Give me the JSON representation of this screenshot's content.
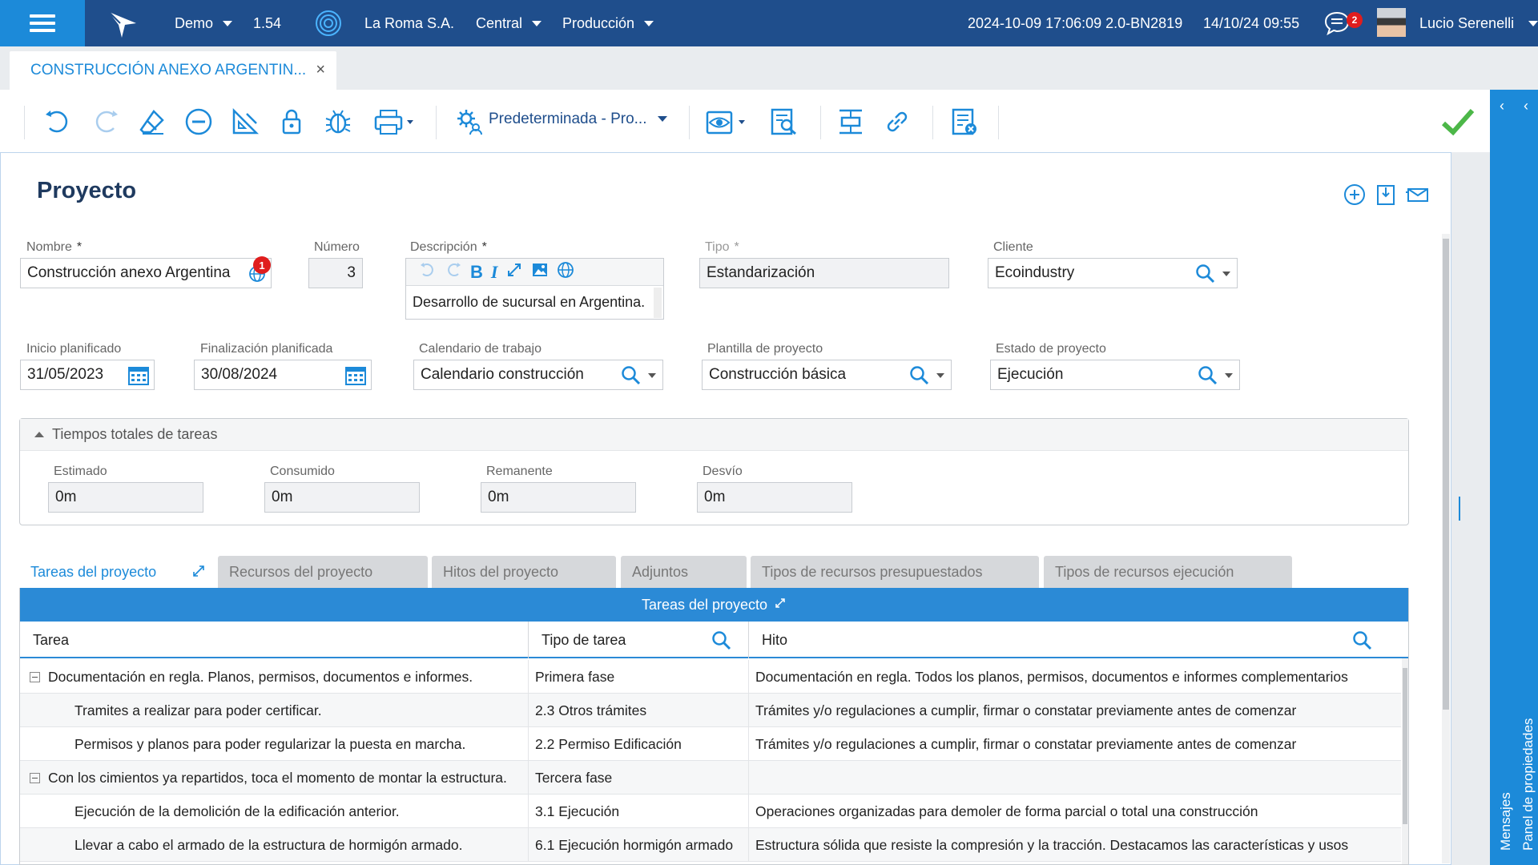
{
  "topbar": {
    "company_switch": "Demo",
    "version": "1.54",
    "organization": "La Roma S.A.",
    "branch": "Central",
    "environment": "Producción",
    "build_info": "2024-10-09 17:06:09 2.0-BN2819",
    "datetime": "14/10/24 09:55",
    "notifications_count": "2",
    "user_name": "Lucio Serenelli",
    "icons": [
      "menu-icon",
      "app-logo-icon",
      "org-logo-icon",
      "chat-icon",
      "avatar"
    ]
  },
  "doc_tab": {
    "title": "CONSTRUCCIÓN ANEXO ARGENTIN...",
    "close": "×"
  },
  "toolbar": {
    "layout_label": "Predeterminada - Pro...",
    "icons": [
      "undo-icon",
      "redo-icon",
      "eraser-icon",
      "remove-icon",
      "ruler-icon",
      "lock-icon",
      "bug-icon",
      "print-icon",
      "layout-gear-icon",
      "view-icon",
      "report-icon",
      "align-icon",
      "link-icon",
      "list-cancel-icon",
      "save-check-icon"
    ]
  },
  "form": {
    "title": "Proyecto",
    "nombre": {
      "label": "Nombre",
      "required": "*",
      "value": "Construcción anexo Argentina",
      "badge": "1"
    },
    "numero": {
      "label": "Número",
      "value": "3"
    },
    "descripcion": {
      "label": "Descripción",
      "required": "*",
      "value": "Desarrollo de sucursal en Argentina."
    },
    "tipo": {
      "label": "Tipo",
      "required": "*",
      "value": "Estandarización"
    },
    "cliente": {
      "label": "Cliente",
      "value": "Ecoindustry"
    },
    "inicio": {
      "label": "Inicio planificado",
      "value": "31/05/2023"
    },
    "fin": {
      "label": "Finalización planificada",
      "value": "30/08/2024"
    },
    "calendario": {
      "label": "Calendario de trabajo",
      "value": "Calendario construcción"
    },
    "plantilla": {
      "label": "Plantilla de proyecto",
      "value": "Construcción básica"
    },
    "estado": {
      "label": "Estado de proyecto",
      "value": "Ejecución"
    }
  },
  "tiempos": {
    "title": "Tiempos totales de tareas",
    "estimado": {
      "label": "Estimado",
      "value": "0m"
    },
    "consumido": {
      "label": "Consumido",
      "value": "0m"
    },
    "remanente": {
      "label": "Remanente",
      "value": "0m"
    },
    "desvio": {
      "label": "Desvío",
      "value": "0m"
    }
  },
  "subtabs": [
    "Tareas del proyecto",
    "Recursos del proyecto",
    "Hitos del proyecto",
    "Adjuntos",
    "Tipos de recursos presupuestados",
    "Tipos de recursos ejecución"
  ],
  "grid": {
    "title": "Tareas del proyecto",
    "columns": [
      "Tarea",
      "Tipo de tarea",
      "Hito"
    ],
    "rows": [
      {
        "tarea": "Documentación en regla. Planos, permisos, documentos e informes.",
        "tipo": "Primera fase",
        "hito": "Documentación en regla. Todos los planos, permisos, documentos e informes complementarios"
      },
      {
        "tarea": "Tramites a realizar para poder certificar.",
        "tipo": "2.3 Otros trámites",
        "hito": "Trámites y/o regulaciones a cumplir, firmar o constatar previamente antes de comenzar"
      },
      {
        "tarea": "Permisos y planos para poder regularizar la puesta en marcha.",
        "tipo": "2.2 Permiso Edificación",
        "hito": "Trámites y/o regulaciones a cumplir, firmar o constatar previamente antes de comenzar"
      },
      {
        "tarea": "Con los cimientos ya repartidos, toca el momento de montar la estructura.",
        "tipo": "Tercera fase",
        "hito": ""
      },
      {
        "tarea": "Ejecución de la demolición de la edificación anterior.",
        "tipo": "3.1 Ejecución",
        "hito": "Operaciones organizadas para demoler de forma parcial o total una construcción"
      },
      {
        "tarea": "Llevar a cabo el armado de la estructura de hormigón armado.",
        "tipo": "6.1 Ejecución hormigón armado",
        "hito": "Estructura sólida que resiste la compresión y la tracción. Destacamos las características y usos"
      }
    ]
  },
  "right_panel": {
    "messages": "Mensajes",
    "properties": "Panel de propiedades"
  },
  "colors": {
    "topbar": "#1f4e8c",
    "accent": "#1c8ad9",
    "grid_header": "#2b8ad6",
    "badge": "#e01d1d",
    "save": "#4cb748"
  }
}
